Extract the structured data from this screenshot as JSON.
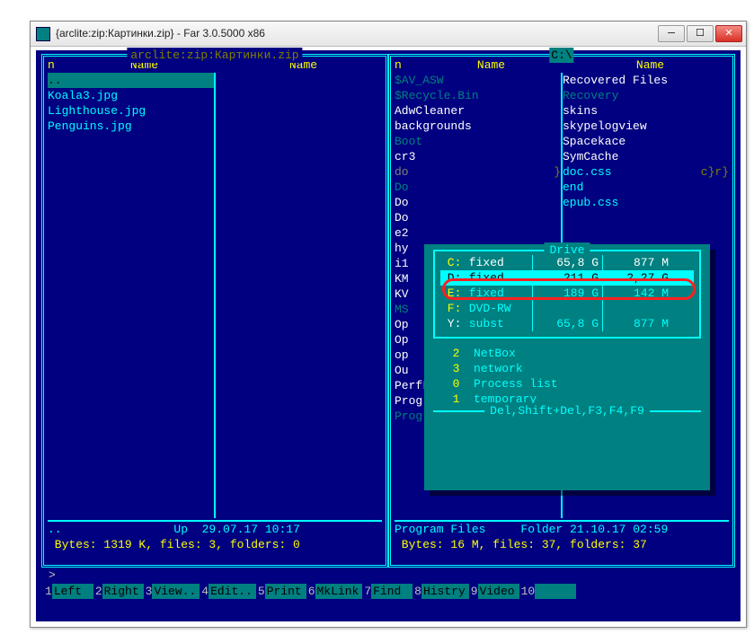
{
  "window": {
    "title": "{arclite:zip:Картинки.zip} - Far 3.0.5000 x86"
  },
  "left_panel": {
    "title": "arclite:zip:Картинки.zip",
    "header": {
      "n": "n",
      "name": "Name"
    },
    "col1": [
      {
        "txt": "..",
        "sel": true
      },
      {
        "txt": "Koala3.jpg"
      },
      {
        "txt": "Lighthouse.jpg"
      },
      {
        "txt": "Penguins.jpg"
      }
    ],
    "col2": [],
    "footer": "..                Up  29.07.17 10:17",
    "stats": " Bytes: 1319 K, files: 3, folders: 0 "
  },
  "right_panel": {
    "title": "C:\\",
    "header": {
      "n": "n",
      "name": "Name"
    },
    "col1": [
      {
        "txt": "$AV_ASW",
        "cls": "hid"
      },
      {
        "txt": "$Recycle.Bin",
        "cls": "hid"
      },
      {
        "txt": "AdwCleaner",
        "cls": "dir"
      },
      {
        "txt": "backgrounds",
        "cls": "dir"
      },
      {
        "txt": "Boot",
        "cls": "hid"
      },
      {
        "txt": "cr3",
        "cls": "dir"
      },
      {
        "txt": "do",
        "cls": "trunc",
        "rb": "}"
      },
      {
        "txt": "Do",
        "cls": "hid"
      },
      {
        "txt": "Do",
        "cls": "dir"
      },
      {
        "txt": "Do",
        "cls": "dir"
      },
      {
        "txt": "e2",
        "cls": "dir"
      },
      {
        "txt": "hy",
        "cls": "dir"
      },
      {
        "txt": "i1",
        "cls": "dir"
      },
      {
        "txt": "KM",
        "cls": "dir"
      },
      {
        "txt": "KV",
        "cls": "dir"
      },
      {
        "txt": "MS",
        "cls": "hid"
      },
      {
        "txt": "Op",
        "cls": "dir"
      },
      {
        "txt": "Op",
        "cls": "dir"
      },
      {
        "txt": "op",
        "cls": "dir"
      },
      {
        "txt": "Ou",
        "cls": "dir"
      },
      {
        "txt": "PerfLogs",
        "cls": "dir"
      },
      {
        "txt": "Program Files",
        "cls": "dir"
      },
      {
        "txt": "ProgramData",
        "cls": "hid"
      }
    ],
    "col2": [
      {
        "txt": "Recovered Files",
        "cls": "dir"
      },
      {
        "txt": "Recovery",
        "cls": "hid"
      },
      {
        "txt": "skins",
        "cls": "dir"
      },
      {
        "txt": "skypelogview",
        "cls": "dir"
      },
      {
        "txt": "Spacekace",
        "cls": "dir"
      },
      {
        "txt": "SymCache",
        "cls": "dir"
      },
      {
        "txt": "",
        "rb": "r}"
      },
      {
        "txt": "",
        "rb": "c}"
      },
      {
        "txt": ""
      },
      {
        "txt": ""
      },
      {
        "txt": ""
      },
      {
        "txt": ""
      },
      {
        "txt": ""
      },
      {
        "txt": ""
      },
      {
        "txt": ""
      },
      {
        "txt": ""
      },
      {
        "txt": ""
      },
      {
        "txt": ""
      },
      {
        "txt": ""
      },
      {
        "txt": ""
      },
      {
        "txt": "doc.css"
      },
      {
        "txt": "end"
      },
      {
        "txt": "epub.css"
      }
    ],
    "footer": "Program Files     Folder 21.10.17 02:59",
    "stats": " Bytes: 16 M, files: 37, folders: 37 "
  },
  "cmdline": ">",
  "fkeys": [
    {
      "n": "1",
      "l": "Left  "
    },
    {
      "n": "2",
      "l": "Right "
    },
    {
      "n": "3",
      "l": "View.."
    },
    {
      "n": "4",
      "l": "Edit.."
    },
    {
      "n": "5",
      "l": "Print "
    },
    {
      "n": "6",
      "l": "MkLink"
    },
    {
      "n": "7",
      "l": "Find  "
    },
    {
      "n": "8",
      "l": "Histry"
    },
    {
      "n": "9",
      "l": "Video "
    },
    {
      "n": "10",
      "l": "      "
    }
  ],
  "drive_dialog": {
    "title": " Drive ",
    "drives": [
      {
        "letter": "C",
        "type": "fixed",
        "size": "65,8 G",
        "free": "877 M",
        "cls": "cur"
      },
      {
        "letter": "D",
        "type": "fixed",
        "size": "211 G",
        "free": "2,27 G",
        "cls": "sel"
      },
      {
        "letter": "E",
        "type": "fixed",
        "size": "189 G",
        "free": "142 M"
      },
      {
        "letter": "F",
        "type": "DVD-RW",
        "size": "",
        "free": ""
      },
      {
        "letter": "Y",
        "type": "subst",
        "size": "65,8 G",
        "free": "877 M",
        "ltr_cls": "ltr-y"
      }
    ],
    "plugins": [
      {
        "n": "2",
        "l": "NetBox"
      },
      {
        "n": "3",
        "l": "network"
      },
      {
        "n": "0",
        "l": "Process list"
      },
      {
        "n": "1",
        "l": "temporary"
      }
    ],
    "bottom": " Del,Shift+Del,F3,F4,F9 "
  }
}
